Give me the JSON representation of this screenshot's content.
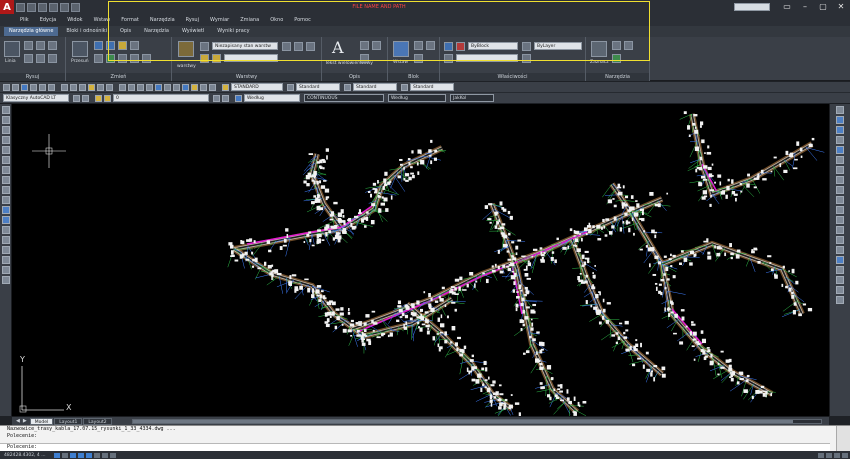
{
  "titlebar": {
    "logo": "A",
    "annotation": "FILE NAME AND PATH",
    "controls": [
      "▭",
      "–",
      "▢",
      "✕"
    ]
  },
  "menu": [
    "Plik",
    "Edycja",
    "Widok",
    "Wstaw",
    "Format",
    "Narzędzia",
    "Rysuj",
    "Wymiar",
    "Zmiana",
    "Okno",
    "Pomoc"
  ],
  "ribbon_tabs": [
    "Narzędzia główne",
    "Bloki i odnośniki",
    "Opis",
    "Narzędzia",
    "Wyświetl",
    "Wyniki pracy"
  ],
  "ribbon": {
    "panels": [
      "Rysuj",
      "Zmień",
      "Warstwy",
      "Opis",
      "Blok",
      "Właściwości",
      "Narzędzia"
    ],
    "line_label": "Linia",
    "move_label": "Przesuń",
    "layer_state": "Niezapisany stan warstw",
    "layer_label": "warstwy",
    "text_label": "Tekst wielowierszowy",
    "insert_label": "Wstaw",
    "color_value": "ByBlock",
    "linetype_value": "ByLayer",
    "group_label": "Zaznacz"
  },
  "toolbar1": {
    "textstyle": "STANDARD",
    "dimstyle": "Standard",
    "tablestyle": "Standard",
    "mleaderstyle": "Standard"
  },
  "toolbar2": {
    "workspace": "Klasyczny AutoCAD LT",
    "layer": "0",
    "color": "Według",
    "linetype": "CONTINUOUS",
    "lineweight": "Według",
    "plotstyle": "JakKol"
  },
  "ucs": {
    "x": "X",
    "y": "Y"
  },
  "layout_tabs": [
    "Model",
    "Layout1",
    "Layout2"
  ],
  "command": {
    "history": [
      "Nazwowice_trasy_kabla_17.07.15_rysunki_1_33_4334.dwg ...",
      "Polecenie:"
    ],
    "prompt": "Polecenie:"
  },
  "status": {
    "coords": "482428.4302, 4 ..."
  }
}
